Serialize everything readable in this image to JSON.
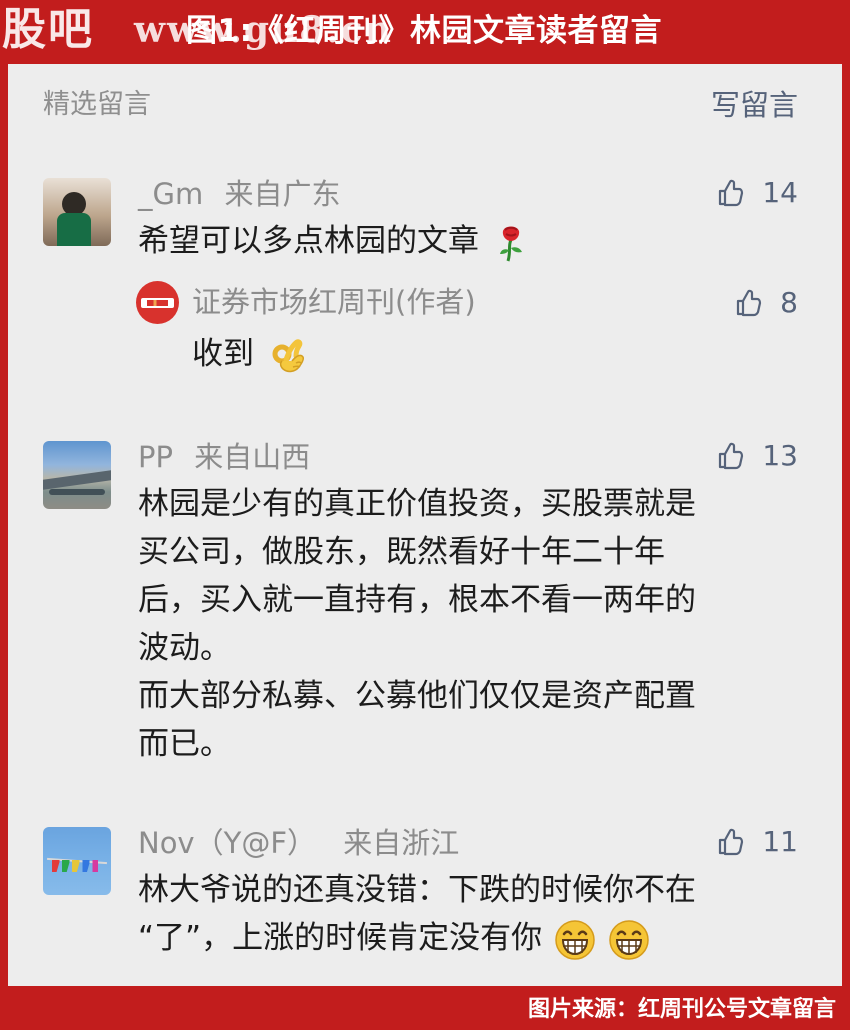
{
  "overlay": {
    "site_brand": "股吧",
    "site_url": "www.gu8.cn",
    "banner_title": "图1:《红周刊》林园文章读者留言",
    "source_caption": "图片来源：红周刊公号文章留言"
  },
  "section": {
    "title": "精选留言",
    "write_button": "写留言"
  },
  "comments": [
    {
      "nickname": "_Gm",
      "location": "来自广东",
      "likes": "14",
      "lines": [
        "希望可以多点林园的文章"
      ],
      "reply": {
        "nickname": "证券市场红周刊(作者)",
        "likes": "8",
        "lines": [
          "收到"
        ]
      }
    },
    {
      "nickname": "PP",
      "location": "来自山西",
      "likes": "13",
      "lines": [
        "林园是少有的真正价值投资，买股票就是",
        "买公司，做股东，既然看好十年二十年",
        "后，买入就一直持有，根本不看一两年的",
        "波动。",
        "而大部分私募、公募他们仅仅是资产配置",
        "而已。"
      ]
    },
    {
      "nickname": "Nov（Y@F）",
      "location": "来自浙江",
      "likes": "11",
      "lines": [
        "林大爷说的还真没错：下跌的时候你不在",
        "“了”，上涨的时候肯定没有你"
      ]
    }
  ],
  "icons": {
    "like": "thumb-up-icon",
    "rose": "rose-emoji",
    "ok": "ok-hand-emoji",
    "grin": "grinning-face-emoji"
  },
  "colors": {
    "banner_red": "#c21d1d",
    "card_bg": "#ededed",
    "link_blue_gray": "#56637a",
    "meta_gray": "#8c8c8c",
    "text_dark": "#1c1c1c"
  }
}
